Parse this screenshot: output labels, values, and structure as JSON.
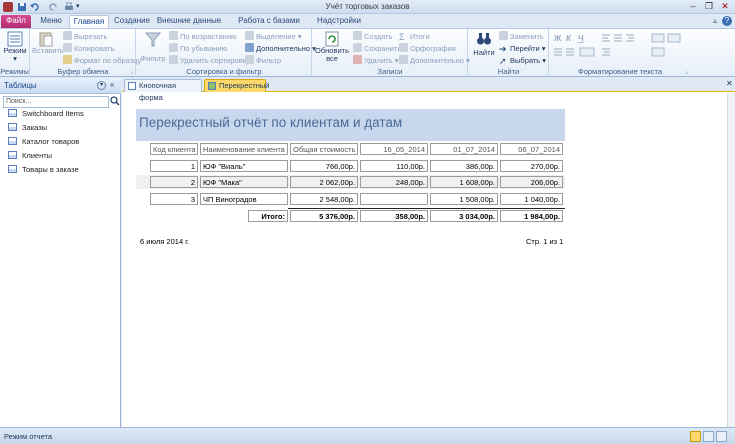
{
  "window": {
    "title": "Учёт торговых заказов",
    "minimize": "–",
    "restore": "❐",
    "close": "✕"
  },
  "tabs": [
    "Файл",
    "Меню",
    "Главная",
    "Создание",
    "Внешние данные",
    "Работа с базами данных",
    "Надстройки"
  ],
  "ribbon": {
    "views": {
      "mode": "Режим",
      "label": "Режимы"
    },
    "clipboard": {
      "paste": "Вставить",
      "cut": "Вырезать",
      "copy": "Копировать",
      "format": "Формат по образцу",
      "label": "Буфер обмена"
    },
    "sort": {
      "filter": "Фильтр",
      "asc": "По возрастанию",
      "desc": "По убыванию",
      "remove": "Удалить сортировку",
      "selection": "Выделение",
      "advanced": "Дополнительно",
      "toggle": "Фильтр",
      "label": "Сортировка и фильтр"
    },
    "records": {
      "refresh": "Обновить",
      "refresh2": "все",
      "new": "Создать",
      "save": "Сохранить",
      "delete": "Удалить",
      "totals": "Итоги",
      "spelling": "Орфография",
      "more": "Дополнительно",
      "label": "Записи"
    },
    "find": {
      "find": "Найти",
      "replace": "Заменить",
      "goto": "Перейти",
      "select": "Выбрать",
      "label": "Найти"
    },
    "text": {
      "label": "Форматирование текста"
    }
  },
  "nav": {
    "header": "Таблицы",
    "search_placeholder": "Поиск...",
    "items": [
      "Switchboard Items",
      "Заказы",
      "Каталог товаров",
      "Клиенты",
      "Товары в заказе"
    ]
  },
  "doc_tabs": [
    "Кнопочная форма",
    "Перекрестный"
  ],
  "report": {
    "title": "Перекрестный отчёт по клиентам и датам",
    "headers": [
      "Код клиента",
      "Наименование клиента",
      "Общая стоимость",
      "16_05_2014",
      "01_07_2014",
      "06_07_2014"
    ],
    "rows": [
      [
        "1",
        "ЮФ \"Виаль\"",
        "766,00р.",
        "110,00р.",
        "386,00р.",
        "270,00р."
      ],
      [
        "2",
        "ЮФ \"Мака\"",
        "2 062,00р.",
        "248,00р.",
        "1 608,00р.",
        "206,00р."
      ],
      [
        "3",
        "ЧП Виноградов",
        "2 548,00р.",
        "",
        "1 508,00р.",
        "1 040,00р."
      ]
    ],
    "total_label": "Итого:",
    "totals": [
      "5 376,00р.",
      "358,00р.",
      "3 034,00р.",
      "1 984,00р."
    ],
    "date": "6 июля 2014 г.",
    "page": "Стр. 1 из 1"
  },
  "status": {
    "text": "Режим отчета"
  }
}
